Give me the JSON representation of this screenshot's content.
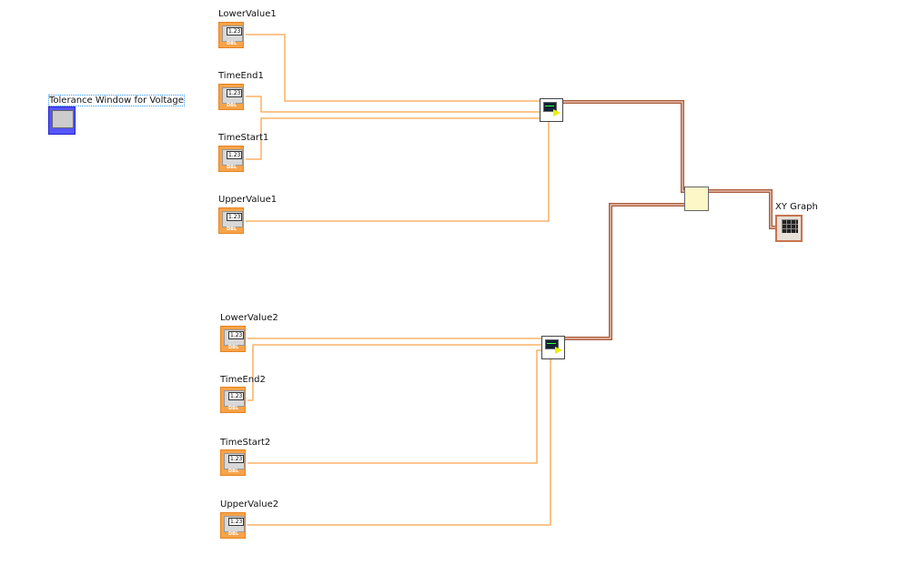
{
  "free_label": "Tolerance Window for Voltage",
  "group1": [
    {
      "label": "LowerValue1"
    },
    {
      "label": "TimeEnd1"
    },
    {
      "label": "TimeStart1"
    },
    {
      "label": "UpperValue1"
    }
  ],
  "group2": [
    {
      "label": "LowerValue2"
    },
    {
      "label": "TimeEnd2"
    },
    {
      "label": "TimeStart2"
    },
    {
      "label": "UpperValue2"
    }
  ],
  "control_text": "1.23",
  "control_type": "DBL",
  "graph_label": "XY Graph",
  "colors": {
    "dbl_wire": "#f7a34a",
    "cluster_wire": "#a85a3a",
    "background": "#ffffff"
  }
}
